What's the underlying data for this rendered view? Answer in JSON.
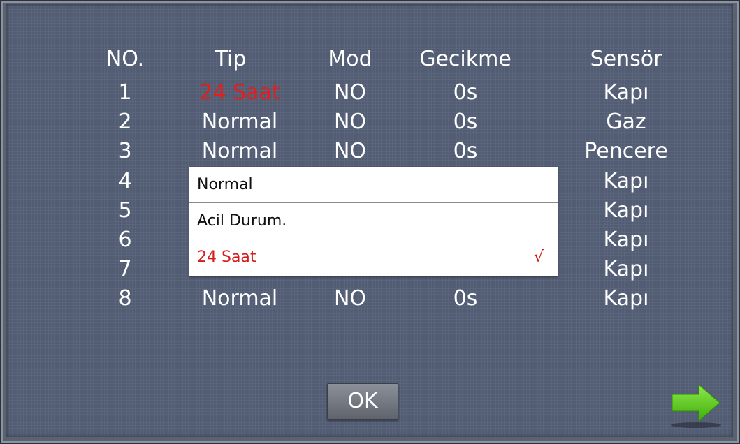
{
  "table": {
    "headers": [
      "NO.",
      "Tip",
      "Mod",
      "Gecikme",
      "Sensör"
    ],
    "rows": [
      {
        "no": "1",
        "tip": "24 Saat",
        "mod": "NO",
        "gecikme": "0s",
        "sensor": "Kapı"
      },
      {
        "no": "2",
        "tip": "Normal",
        "mod": "NO",
        "gecikme": "0s",
        "sensor": "Gaz"
      },
      {
        "no": "3",
        "tip": "Normal",
        "mod": "NO",
        "gecikme": "0s",
        "sensor": "Pencere"
      },
      {
        "no": "4",
        "tip": "",
        "mod": "",
        "gecikme": "",
        "sensor": "Kapı"
      },
      {
        "no": "5",
        "tip": "",
        "mod": "",
        "gecikme": "",
        "sensor": "Kapı"
      },
      {
        "no": "6",
        "tip": "",
        "mod": "",
        "gecikme": "",
        "sensor": "Kapı"
      },
      {
        "no": "7",
        "tip": "",
        "mod": "",
        "gecikme": "",
        "sensor": "Kapı"
      },
      {
        "no": "8",
        "tip": "Normal",
        "mod": "NO",
        "gecikme": "0s",
        "sensor": "Kapı"
      }
    ]
  },
  "dropdown": {
    "options": [
      "Normal",
      "Acil Durum.",
      "24 Saat"
    ],
    "selected_check": "√"
  },
  "ok_label": "OK",
  "colors": {
    "background": "#525d74",
    "highlight": "#e41e1e",
    "next_arrow": "#5fd119"
  },
  "icons": {
    "next": "right-arrow-icon",
    "selected": "checkmark-icon"
  }
}
